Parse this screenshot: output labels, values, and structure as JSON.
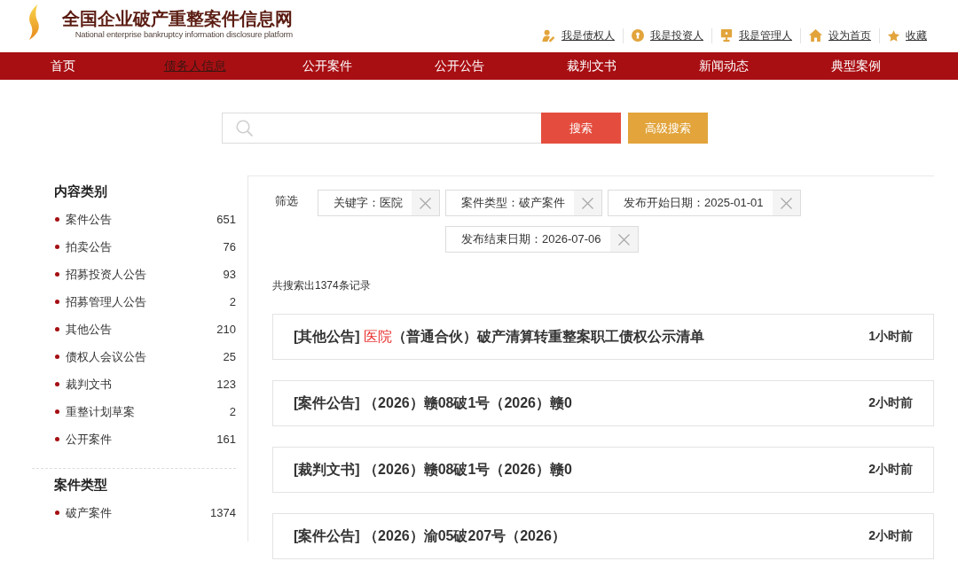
{
  "site": {
    "title": "全国企业破产重整案件信息网",
    "subtitle": "National enterprise bankruptcy information disclosure platform"
  },
  "top_links": [
    "我是债权人",
    "我是投资人",
    "我是管理人",
    "设为首页",
    "收藏"
  ],
  "nav": [
    {
      "label": "首页",
      "selected": false
    },
    {
      "label": "债务人信息",
      "selected": true
    },
    {
      "label": "公开案件",
      "selected": false
    },
    {
      "label": "公开公告",
      "selected": false
    },
    {
      "label": "裁判文书",
      "selected": false
    },
    {
      "label": "新闻动态",
      "selected": false
    },
    {
      "label": "典型案例",
      "selected": false
    }
  ],
  "search": {
    "buttons": [
      {
        "label": "搜索",
        "kind": "primary"
      },
      {
        "label": "高级搜索",
        "kind": "advanced"
      }
    ]
  },
  "sidebar": [
    {
      "heading": "内容类别",
      "items": [
        {
          "label": "案件公告",
          "count": "651"
        },
        {
          "label": "拍卖公告",
          "count": "76"
        },
        {
          "label": "招募投资人公告",
          "count": "93"
        },
        {
          "label": "招募管理人公告",
          "count": "2"
        },
        {
          "label": "其他公告",
          "count": "210"
        },
        {
          "label": "债权人会议公告",
          "count": "25"
        },
        {
          "label": "裁判文书",
          "count": "123"
        },
        {
          "label": "重整计划草案",
          "count": "2"
        },
        {
          "label": "公开案件",
          "count": "161"
        }
      ]
    },
    {
      "heading": "案件类型",
      "items": [
        {
          "label": "破产案件",
          "count": "1374"
        }
      ]
    }
  ],
  "filters": {
    "label": "筛选",
    "chips": [
      "关键字：医院",
      "案件类型：破产案件",
      "发布开始日期：2025-01-01",
      "发布结束日期：2026-07-06"
    ]
  },
  "result_count": "共搜索出1374条记录",
  "results": [
    {
      "title": [
        {
          "text": "[其他公告] ",
          "highlight": false
        },
        {
          "text": "医院",
          "highlight": true
        },
        {
          "text": "（普通合伙）破产清算转重整案职工债权公示清单",
          "highlight": false
        }
      ],
      "time": "1小时前"
    },
    {
      "title": [
        {
          "text": "[案件公告] （2026）赣08破1号（2026）赣0",
          "highlight": false
        }
      ],
      "time": "2小时前"
    },
    {
      "title": [
        {
          "text": "[裁判文书] （2026）赣08破1号（2026）赣0",
          "highlight": false
        }
      ],
      "time": "2小时前"
    },
    {
      "title": [
        {
          "text": "[案件公告] （2026）渝05破207号（2026）",
          "highlight": false
        }
      ],
      "time": "2小时前"
    }
  ]
}
